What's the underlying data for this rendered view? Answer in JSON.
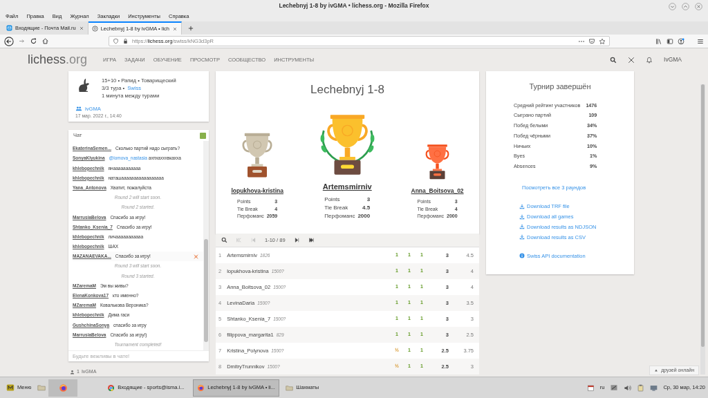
{
  "window": {
    "title": "Lechebnyj 1-8 by ivGMA • lichess.org - Mozilla Firefox"
  },
  "menu": [
    "Файл",
    "Правка",
    "Вид",
    "Журнал",
    "Закладки",
    "Инструменты",
    "Справка"
  ],
  "tabs": [
    {
      "label": "Входящие - Почта Mail.ru",
      "kind": "mail",
      "selected": false
    },
    {
      "label": "Lechebnyj 1-8 by ivGMA • lich",
      "kind": "lichess",
      "selected": true
    }
  ],
  "address": {
    "scheme": "https://",
    "host": "lichess.org",
    "path": "/swiss/kNG3d3pR"
  },
  "site": {
    "logo": "lichess",
    "logo_tld": ".org",
    "nav": [
      "ИГРА",
      "ЗАДАЧИ",
      "ОБУЧЕНИЕ",
      "ПРОСМОТР",
      "СООБЩЕСТВО",
      "ИНСТРУМЕНТЫ"
    ],
    "user": "IvGMA"
  },
  "info": {
    "line1": "15+10 • Рапид • Товарищеский",
    "rounds": "3/3 тура •",
    "format": "Swiss",
    "pause": "1 минута между турами",
    "team": "ivGMA",
    "date": "17 мар. 2022 г., 14:40"
  },
  "chat": {
    "title": "Чат",
    "enabled": true,
    "placeholder": "Будьте вежливы в чате!",
    "messages": [
      {
        "kind": "msg",
        "user": "EkaterinaSemen...",
        "text": "Сколько партий надо сыграть?",
        "hover": false
      },
      {
        "kind": "msg",
        "user": "SonyaKlyukina",
        "mention": "@lomova_nastasia",
        "text": "ахпхахххвкахха",
        "hover": false
      },
      {
        "kind": "msg",
        "user": "khlebopechnik",
        "text": "янааааааааааа",
        "hover": false
      },
      {
        "kind": "msg",
        "user": "khlebopechnik",
        "text": "наташааааааааааааааааа",
        "hover": false
      },
      {
        "kind": "msg",
        "user": "Yana_Antonova",
        "text": "Хватит, пожалуйста",
        "hover": false
      },
      {
        "kind": "system",
        "text": "Round 2 will start soon."
      },
      {
        "kind": "system",
        "text": "Round 2 started."
      },
      {
        "kind": "msg",
        "user": "MarrusiaBelova",
        "text": "Спасибо за игру!",
        "hover": false
      },
      {
        "kind": "msg",
        "user": "Shtanko_Ksenia_7",
        "text": "Спасибо за игру!",
        "hover": false
      },
      {
        "kind": "msg",
        "user": "khlebopechnik",
        "text": "личааааааааааа",
        "hover": false
      },
      {
        "kind": "msg",
        "user": "khlebopechnik",
        "text": "ШАХ",
        "hover": false
      },
      {
        "kind": "msg",
        "user": "MAZANAEVAKA...",
        "text": "Спасибо за игру!",
        "hover": true
      },
      {
        "kind": "system",
        "text": "Round 3 will start soon."
      },
      {
        "kind": "system",
        "text": "Round 3 started."
      },
      {
        "kind": "msg",
        "user": "MZaremaM",
        "text": "Эм вы живы?",
        "hover": false
      },
      {
        "kind": "msg",
        "user": "ElenaKonkova17",
        "text": "кто именно?",
        "hover": false
      },
      {
        "kind": "msg",
        "user": "MZaremaM",
        "text": "Ковалькова Вероника?",
        "hover": false
      },
      {
        "kind": "msg",
        "user": "khlebopechnik",
        "text": "Дима гаси",
        "hover": false
      },
      {
        "kind": "msg",
        "user": "GushchinaSonya",
        "text": "спасибо за игру",
        "hover": false
      },
      {
        "kind": "msg",
        "user": "MarrusiaBelova",
        "text": "Спасибо за игру!)",
        "hover": false
      },
      {
        "kind": "system",
        "text": "Tournament completed!"
      }
    ]
  },
  "watchers": {
    "count": "1",
    "user": "IvGMA"
  },
  "podium": {
    "title": "Lechebnyj 1-8",
    "players": [
      {
        "kind": "silver",
        "name": "lopukhova-kristina",
        "stats": [
          {
            "label": "Points",
            "value": "3"
          },
          {
            "label": "Tie Break",
            "value": "4"
          },
          {
            "label": "Перфоманс",
            "value": "2059"
          }
        ]
      },
      {
        "kind": "gold",
        "name": "Artemsmirniv",
        "stats": [
          {
            "label": "Points",
            "value": "3"
          },
          {
            "label": "Tie Break",
            "value": "4.5"
          },
          {
            "label": "Перфоманс",
            "value": "2000"
          }
        ]
      },
      {
        "kind": "bronze",
        "name": "Anna_Boitsova_02",
        "stats": [
          {
            "label": "Points",
            "value": "3"
          },
          {
            "label": "Tie Break",
            "value": "4"
          },
          {
            "label": "Перфоманс",
            "value": "2000"
          }
        ]
      }
    ]
  },
  "pager": [
    {
      "kind": "search",
      "disabled": false
    },
    {
      "kind": "first",
      "disabled": true
    },
    {
      "kind": "prev",
      "disabled": true
    },
    {
      "kind": "range",
      "label": "1-10 / 89",
      "disabled": false
    },
    {
      "kind": "next",
      "disabled": false
    },
    {
      "kind": "last",
      "disabled": false
    }
  ],
  "standings": [
    {
      "rank": "1",
      "name": "Artemsmirniv",
      "rating": "1826",
      "results": [
        {
          "text": "1",
          "kind": "win"
        },
        {
          "text": "1",
          "kind": "win"
        },
        {
          "text": "1",
          "kind": "win"
        }
      ],
      "points": "3",
      "tiebreak": "4.5"
    },
    {
      "rank": "2",
      "name": "lopukhova-kristina",
      "rating": "1500?",
      "results": [
        {
          "text": "1",
          "kind": "win"
        },
        {
          "text": "1",
          "kind": "win"
        },
        {
          "text": "1",
          "kind": "win"
        }
      ],
      "points": "3",
      "tiebreak": "4"
    },
    {
      "rank": "3",
      "name": "Anna_Boitsova_02",
      "rating": "1500?",
      "results": [
        {
          "text": "1",
          "kind": "win"
        },
        {
          "text": "1",
          "kind": "win"
        },
        {
          "text": "1",
          "kind": "win"
        }
      ],
      "points": "3",
      "tiebreak": "4"
    },
    {
      "rank": "4",
      "name": "LevinaDaria",
      "rating": "1500?",
      "results": [
        {
          "text": "1",
          "kind": "win"
        },
        {
          "text": "1",
          "kind": "win"
        },
        {
          "text": "1",
          "kind": "win"
        }
      ],
      "points": "3",
      "tiebreak": "3.5"
    },
    {
      "rank": "5",
      "name": "Shtanko_Ksenia_7",
      "rating": "1500?",
      "results": [
        {
          "text": "1",
          "kind": "win"
        },
        {
          "text": "1",
          "kind": "win"
        },
        {
          "text": "1",
          "kind": "win"
        }
      ],
      "points": "3",
      "tiebreak": "3"
    },
    {
      "rank": "6",
      "name": "filippova_margarita1",
      "rating": "829",
      "results": [
        {
          "text": "1",
          "kind": "win"
        },
        {
          "text": "1",
          "kind": "win"
        },
        {
          "text": "1",
          "kind": "win"
        }
      ],
      "points": "3",
      "tiebreak": "2.5"
    },
    {
      "rank": "7",
      "name": "Kristina_Polynova",
      "rating": "1500?",
      "results": [
        {
          "text": "½",
          "kind": "draw"
        },
        {
          "text": "1",
          "kind": "win"
        },
        {
          "text": "1",
          "kind": "win"
        }
      ],
      "points": "2.5",
      "tiebreak": "3.75"
    },
    {
      "rank": "8",
      "name": "DmitryTrunnikov",
      "rating": "1500?",
      "results": [
        {
          "text": "½",
          "kind": "draw"
        },
        {
          "text": "1",
          "kind": "win"
        },
        {
          "text": "1",
          "kind": "win"
        }
      ],
      "points": "2.5",
      "tiebreak": "3"
    }
  ],
  "summary": {
    "title": "Турнир завершён",
    "stats": [
      {
        "label": "Средний рейтинг участников",
        "value": "1476"
      },
      {
        "label": "Сыграно партий",
        "value": "109"
      },
      {
        "label": "Побед белыми",
        "value": "34%"
      },
      {
        "label": "Побед чёрными",
        "value": "37%"
      },
      {
        "label": "Ничьих",
        "value": "10%"
      },
      {
        "label": "Byes",
        "value": "1%"
      },
      {
        "label": "Absences",
        "value": "9%"
      }
    ],
    "rounds_link": "Посмотреть все 3 раундов",
    "downloads": [
      "Download TRF file",
      "Download all games",
      "Download results as NDJSON",
      "Download results as CSV"
    ],
    "api": "Swiss API documentation"
  },
  "friends": "друзей онлайн",
  "taskbar": {
    "start": "Меню",
    "tasks": [
      {
        "label": "Входящие - sports@isma.i...",
        "kind": "chrome",
        "selected": false
      },
      {
        "label": "Lechebnyj 1-8 by ivGMA • li...",
        "kind": "firefox",
        "selected": true
      },
      {
        "label": "Шахматы",
        "kind": "folder",
        "selected": false
      }
    ],
    "lang": "ru",
    "clock": "Ср, 30 мар, 14:20"
  }
}
